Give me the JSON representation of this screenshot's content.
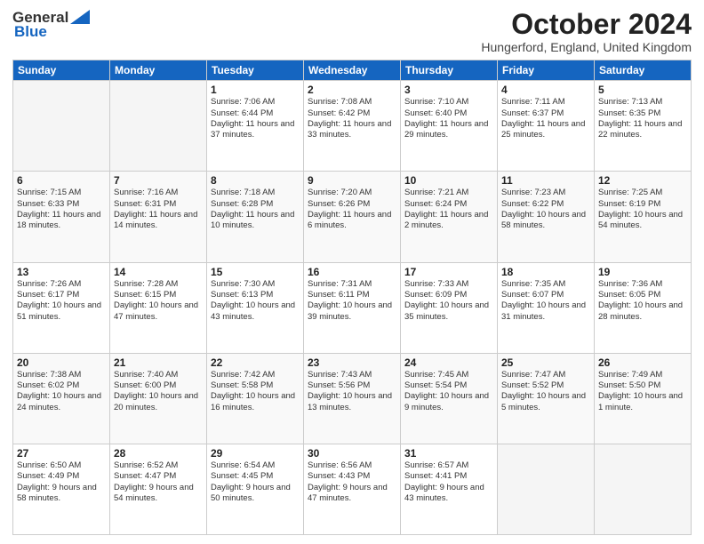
{
  "header": {
    "logo_general": "General",
    "logo_blue": "Blue",
    "month_title": "October 2024",
    "location": "Hungerford, England, United Kingdom"
  },
  "days_of_week": [
    "Sunday",
    "Monday",
    "Tuesday",
    "Wednesday",
    "Thursday",
    "Friday",
    "Saturday"
  ],
  "weeks": [
    [
      {
        "day": "",
        "info": ""
      },
      {
        "day": "",
        "info": ""
      },
      {
        "day": "1",
        "info": "Sunrise: 7:06 AM\nSunset: 6:44 PM\nDaylight: 11 hours and 37 minutes."
      },
      {
        "day": "2",
        "info": "Sunrise: 7:08 AM\nSunset: 6:42 PM\nDaylight: 11 hours and 33 minutes."
      },
      {
        "day": "3",
        "info": "Sunrise: 7:10 AM\nSunset: 6:40 PM\nDaylight: 11 hours and 29 minutes."
      },
      {
        "day": "4",
        "info": "Sunrise: 7:11 AM\nSunset: 6:37 PM\nDaylight: 11 hours and 25 minutes."
      },
      {
        "day": "5",
        "info": "Sunrise: 7:13 AM\nSunset: 6:35 PM\nDaylight: 11 hours and 22 minutes."
      }
    ],
    [
      {
        "day": "6",
        "info": "Sunrise: 7:15 AM\nSunset: 6:33 PM\nDaylight: 11 hours and 18 minutes."
      },
      {
        "day": "7",
        "info": "Sunrise: 7:16 AM\nSunset: 6:31 PM\nDaylight: 11 hours and 14 minutes."
      },
      {
        "day": "8",
        "info": "Sunrise: 7:18 AM\nSunset: 6:28 PM\nDaylight: 11 hours and 10 minutes."
      },
      {
        "day": "9",
        "info": "Sunrise: 7:20 AM\nSunset: 6:26 PM\nDaylight: 11 hours and 6 minutes."
      },
      {
        "day": "10",
        "info": "Sunrise: 7:21 AM\nSunset: 6:24 PM\nDaylight: 11 hours and 2 minutes."
      },
      {
        "day": "11",
        "info": "Sunrise: 7:23 AM\nSunset: 6:22 PM\nDaylight: 10 hours and 58 minutes."
      },
      {
        "day": "12",
        "info": "Sunrise: 7:25 AM\nSunset: 6:19 PM\nDaylight: 10 hours and 54 minutes."
      }
    ],
    [
      {
        "day": "13",
        "info": "Sunrise: 7:26 AM\nSunset: 6:17 PM\nDaylight: 10 hours and 51 minutes."
      },
      {
        "day": "14",
        "info": "Sunrise: 7:28 AM\nSunset: 6:15 PM\nDaylight: 10 hours and 47 minutes."
      },
      {
        "day": "15",
        "info": "Sunrise: 7:30 AM\nSunset: 6:13 PM\nDaylight: 10 hours and 43 minutes."
      },
      {
        "day": "16",
        "info": "Sunrise: 7:31 AM\nSunset: 6:11 PM\nDaylight: 10 hours and 39 minutes."
      },
      {
        "day": "17",
        "info": "Sunrise: 7:33 AM\nSunset: 6:09 PM\nDaylight: 10 hours and 35 minutes."
      },
      {
        "day": "18",
        "info": "Sunrise: 7:35 AM\nSunset: 6:07 PM\nDaylight: 10 hours and 31 minutes."
      },
      {
        "day": "19",
        "info": "Sunrise: 7:36 AM\nSunset: 6:05 PM\nDaylight: 10 hours and 28 minutes."
      }
    ],
    [
      {
        "day": "20",
        "info": "Sunrise: 7:38 AM\nSunset: 6:02 PM\nDaylight: 10 hours and 24 minutes."
      },
      {
        "day": "21",
        "info": "Sunrise: 7:40 AM\nSunset: 6:00 PM\nDaylight: 10 hours and 20 minutes."
      },
      {
        "day": "22",
        "info": "Sunrise: 7:42 AM\nSunset: 5:58 PM\nDaylight: 10 hours and 16 minutes."
      },
      {
        "day": "23",
        "info": "Sunrise: 7:43 AM\nSunset: 5:56 PM\nDaylight: 10 hours and 13 minutes."
      },
      {
        "day": "24",
        "info": "Sunrise: 7:45 AM\nSunset: 5:54 PM\nDaylight: 10 hours and 9 minutes."
      },
      {
        "day": "25",
        "info": "Sunrise: 7:47 AM\nSunset: 5:52 PM\nDaylight: 10 hours and 5 minutes."
      },
      {
        "day": "26",
        "info": "Sunrise: 7:49 AM\nSunset: 5:50 PM\nDaylight: 10 hours and 1 minute."
      }
    ],
    [
      {
        "day": "27",
        "info": "Sunrise: 6:50 AM\nSunset: 4:49 PM\nDaylight: 9 hours and 58 minutes."
      },
      {
        "day": "28",
        "info": "Sunrise: 6:52 AM\nSunset: 4:47 PM\nDaylight: 9 hours and 54 minutes."
      },
      {
        "day": "29",
        "info": "Sunrise: 6:54 AM\nSunset: 4:45 PM\nDaylight: 9 hours and 50 minutes."
      },
      {
        "day": "30",
        "info": "Sunrise: 6:56 AM\nSunset: 4:43 PM\nDaylight: 9 hours and 47 minutes."
      },
      {
        "day": "31",
        "info": "Sunrise: 6:57 AM\nSunset: 4:41 PM\nDaylight: 9 hours and 43 minutes."
      },
      {
        "day": "",
        "info": ""
      },
      {
        "day": "",
        "info": ""
      }
    ]
  ]
}
